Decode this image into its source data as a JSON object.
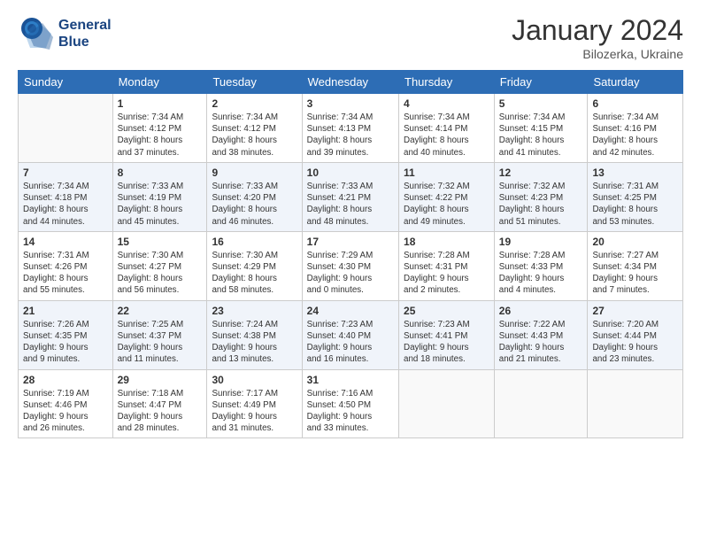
{
  "header": {
    "logo_line1": "General",
    "logo_line2": "Blue",
    "month": "January 2024",
    "location": "Bilozerka, Ukraine"
  },
  "weekdays": [
    "Sunday",
    "Monday",
    "Tuesday",
    "Wednesday",
    "Thursday",
    "Friday",
    "Saturday"
  ],
  "weeks": [
    [
      {
        "day": "",
        "info": ""
      },
      {
        "day": "1",
        "info": "Sunrise: 7:34 AM\nSunset: 4:12 PM\nDaylight: 8 hours\nand 37 minutes."
      },
      {
        "day": "2",
        "info": "Sunrise: 7:34 AM\nSunset: 4:12 PM\nDaylight: 8 hours\nand 38 minutes."
      },
      {
        "day": "3",
        "info": "Sunrise: 7:34 AM\nSunset: 4:13 PM\nDaylight: 8 hours\nand 39 minutes."
      },
      {
        "day": "4",
        "info": "Sunrise: 7:34 AM\nSunset: 4:14 PM\nDaylight: 8 hours\nand 40 minutes."
      },
      {
        "day": "5",
        "info": "Sunrise: 7:34 AM\nSunset: 4:15 PM\nDaylight: 8 hours\nand 41 minutes."
      },
      {
        "day": "6",
        "info": "Sunrise: 7:34 AM\nSunset: 4:16 PM\nDaylight: 8 hours\nand 42 minutes."
      }
    ],
    [
      {
        "day": "7",
        "info": "Sunrise: 7:34 AM\nSunset: 4:18 PM\nDaylight: 8 hours\nand 44 minutes."
      },
      {
        "day": "8",
        "info": "Sunrise: 7:33 AM\nSunset: 4:19 PM\nDaylight: 8 hours\nand 45 minutes."
      },
      {
        "day": "9",
        "info": "Sunrise: 7:33 AM\nSunset: 4:20 PM\nDaylight: 8 hours\nand 46 minutes."
      },
      {
        "day": "10",
        "info": "Sunrise: 7:33 AM\nSunset: 4:21 PM\nDaylight: 8 hours\nand 48 minutes."
      },
      {
        "day": "11",
        "info": "Sunrise: 7:32 AM\nSunset: 4:22 PM\nDaylight: 8 hours\nand 49 minutes."
      },
      {
        "day": "12",
        "info": "Sunrise: 7:32 AM\nSunset: 4:23 PM\nDaylight: 8 hours\nand 51 minutes."
      },
      {
        "day": "13",
        "info": "Sunrise: 7:31 AM\nSunset: 4:25 PM\nDaylight: 8 hours\nand 53 minutes."
      }
    ],
    [
      {
        "day": "14",
        "info": "Sunrise: 7:31 AM\nSunset: 4:26 PM\nDaylight: 8 hours\nand 55 minutes."
      },
      {
        "day": "15",
        "info": "Sunrise: 7:30 AM\nSunset: 4:27 PM\nDaylight: 8 hours\nand 56 minutes."
      },
      {
        "day": "16",
        "info": "Sunrise: 7:30 AM\nSunset: 4:29 PM\nDaylight: 8 hours\nand 58 minutes."
      },
      {
        "day": "17",
        "info": "Sunrise: 7:29 AM\nSunset: 4:30 PM\nDaylight: 9 hours\nand 0 minutes."
      },
      {
        "day": "18",
        "info": "Sunrise: 7:28 AM\nSunset: 4:31 PM\nDaylight: 9 hours\nand 2 minutes."
      },
      {
        "day": "19",
        "info": "Sunrise: 7:28 AM\nSunset: 4:33 PM\nDaylight: 9 hours\nand 4 minutes."
      },
      {
        "day": "20",
        "info": "Sunrise: 7:27 AM\nSunset: 4:34 PM\nDaylight: 9 hours\nand 7 minutes."
      }
    ],
    [
      {
        "day": "21",
        "info": "Sunrise: 7:26 AM\nSunset: 4:35 PM\nDaylight: 9 hours\nand 9 minutes."
      },
      {
        "day": "22",
        "info": "Sunrise: 7:25 AM\nSunset: 4:37 PM\nDaylight: 9 hours\nand 11 minutes."
      },
      {
        "day": "23",
        "info": "Sunrise: 7:24 AM\nSunset: 4:38 PM\nDaylight: 9 hours\nand 13 minutes."
      },
      {
        "day": "24",
        "info": "Sunrise: 7:23 AM\nSunset: 4:40 PM\nDaylight: 9 hours\nand 16 minutes."
      },
      {
        "day": "25",
        "info": "Sunrise: 7:23 AM\nSunset: 4:41 PM\nDaylight: 9 hours\nand 18 minutes."
      },
      {
        "day": "26",
        "info": "Sunrise: 7:22 AM\nSunset: 4:43 PM\nDaylight: 9 hours\nand 21 minutes."
      },
      {
        "day": "27",
        "info": "Sunrise: 7:20 AM\nSunset: 4:44 PM\nDaylight: 9 hours\nand 23 minutes."
      }
    ],
    [
      {
        "day": "28",
        "info": "Sunrise: 7:19 AM\nSunset: 4:46 PM\nDaylight: 9 hours\nand 26 minutes."
      },
      {
        "day": "29",
        "info": "Sunrise: 7:18 AM\nSunset: 4:47 PM\nDaylight: 9 hours\nand 28 minutes."
      },
      {
        "day": "30",
        "info": "Sunrise: 7:17 AM\nSunset: 4:49 PM\nDaylight: 9 hours\nand 31 minutes."
      },
      {
        "day": "31",
        "info": "Sunrise: 7:16 AM\nSunset: 4:50 PM\nDaylight: 9 hours\nand 33 minutes."
      },
      {
        "day": "",
        "info": ""
      },
      {
        "day": "",
        "info": ""
      },
      {
        "day": "",
        "info": ""
      }
    ]
  ]
}
